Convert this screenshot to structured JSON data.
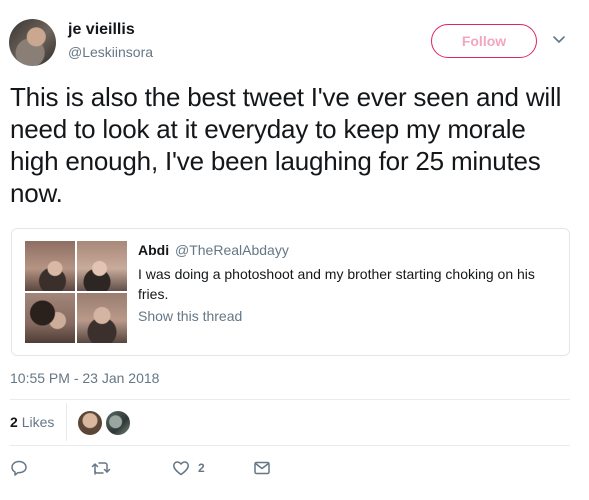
{
  "header": {
    "name": "je vieillis",
    "handle": "@Leskiinsora",
    "follow_label": "Follow"
  },
  "tweet": {
    "text": "This is also the best tweet I've ever seen and will need to look at it everyday to keep my morale high enough, I've been laughing for 25 minutes now."
  },
  "quoted": {
    "name": "Abdi",
    "handle": "@TheRealAbdayy",
    "text": "I was doing a photoshoot and my brother starting choking on his fries.",
    "link_label": "Show this thread"
  },
  "meta": {
    "timestamp": "10:55 PM - 23 Jan 2018",
    "likes_count": "2",
    "likes_label": "Likes"
  },
  "actions": {
    "like_count": "2",
    "icons": [
      "reply-icon",
      "retweet-icon",
      "heart-icon",
      "envelope-icon"
    ]
  },
  "colors": {
    "follow_border": "#e0245e",
    "secondary_text": "#657786",
    "primary_text": "#14171a"
  }
}
